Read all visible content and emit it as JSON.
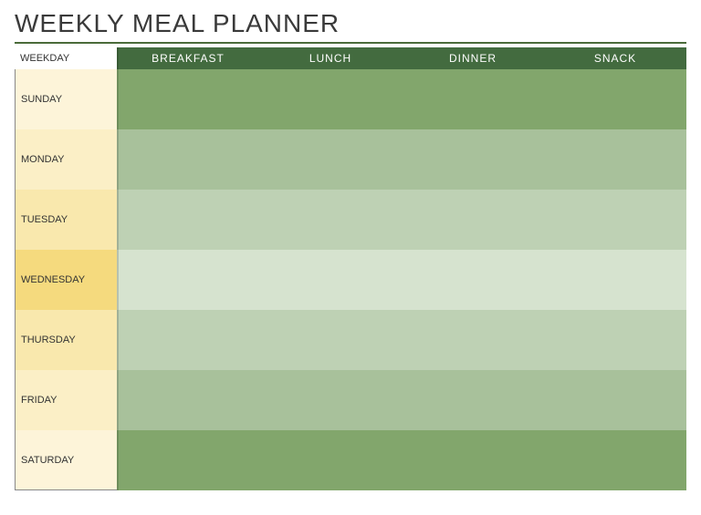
{
  "title": "WEEKLY MEAL PLANNER",
  "header": {
    "weekday_label": "WEEKDAY",
    "meals": [
      "BREAKFAST",
      "LUNCH",
      "DINNER",
      "SNACK"
    ]
  },
  "days": [
    {
      "name": "SUNDAY",
      "breakfast": "",
      "lunch": "",
      "dinner": "",
      "snack": ""
    },
    {
      "name": "MONDAY",
      "breakfast": "",
      "lunch": "",
      "dinner": "",
      "snack": ""
    },
    {
      "name": "TUESDAY",
      "breakfast": "",
      "lunch": "",
      "dinner": "",
      "snack": ""
    },
    {
      "name": "WEDNESDAY",
      "breakfast": "",
      "lunch": "",
      "dinner": "",
      "snack": ""
    },
    {
      "name": "THURSDAY",
      "breakfast": "",
      "lunch": "",
      "dinner": "",
      "snack": ""
    },
    {
      "name": "FRIDAY",
      "breakfast": "",
      "lunch": "",
      "dinner": "",
      "snack": ""
    },
    {
      "name": "SATURDAY",
      "breakfast": "",
      "lunch": "",
      "dinner": "",
      "snack": ""
    }
  ],
  "colors": {
    "header_green": "#436b3f",
    "title_rule": "#4a6b3a"
  }
}
